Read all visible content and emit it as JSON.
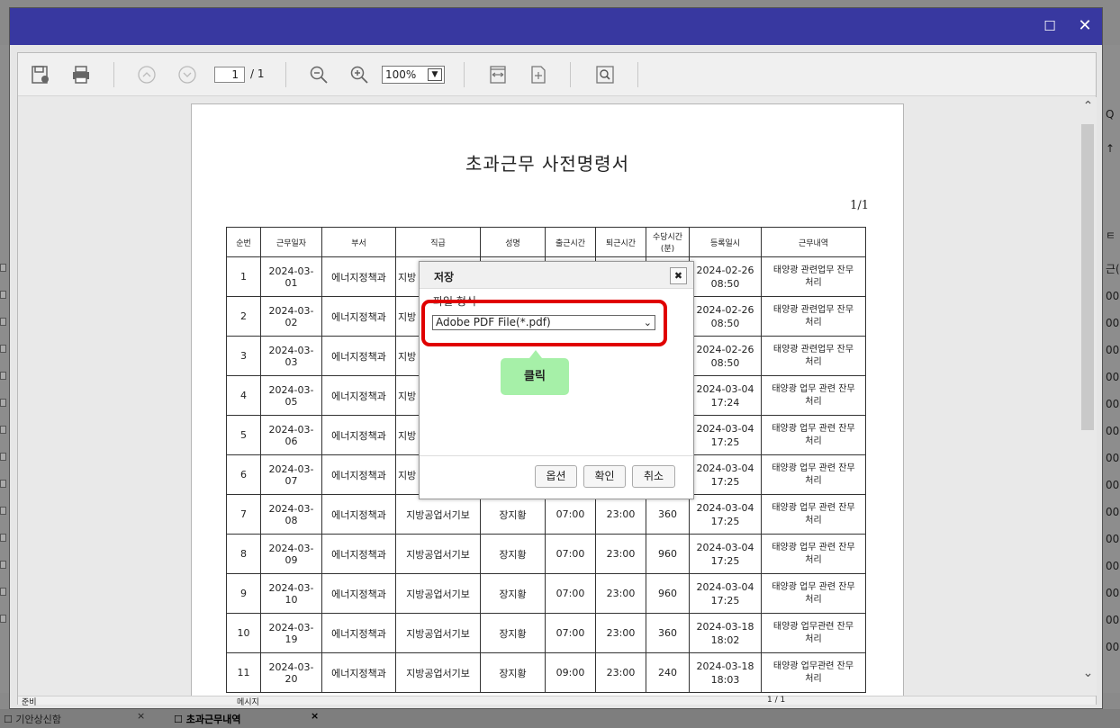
{
  "background": {
    "right_values": [
      "Q",
      "↑",
      "ㅌ",
      "근(",
      "00:",
      "00:",
      "00:",
      "00:",
      "00:",
      "00:",
      "00:",
      "00:",
      "00:",
      "00:",
      "00:",
      "00:",
      "00:",
      "00:"
    ],
    "tabs": [
      {
        "label": "기안상신함",
        "close": "×"
      },
      {
        "label": "초과근무내역",
        "close": "×"
      }
    ]
  },
  "window": {
    "maximize_icon": "☐",
    "close_icon": "✕"
  },
  "toolbar": {
    "page_current": "1",
    "page_total": "/ 1",
    "zoom": "100%",
    "zoom_arrow": "▼",
    "icons": [
      "save-icon",
      "print-icon",
      "prev-page-icon",
      "next-page-icon",
      "zoom-out-icon",
      "zoom-in-icon",
      "fit-width-icon",
      "fit-page-icon",
      "search-icon"
    ]
  },
  "document": {
    "title": "초과근무 사전명령서",
    "page_number": "1/1",
    "headers": [
      "순번",
      "근무일자",
      "부서",
      "직급",
      "성명",
      "출근시간",
      "퇴근시간",
      "수당시간\n(분)",
      "등록일시",
      "근무내역"
    ],
    "rows": [
      {
        "no": "1",
        "date": "2024-03-01",
        "dept": "에너지정책과",
        "rank": "지방",
        "name": "",
        "in": "",
        "out": "",
        "minutes": "",
        "reg": "2024-02-26\n08:50",
        "desc": "태양광 관련업무 잔무\n처리"
      },
      {
        "no": "2",
        "date": "2024-03-02",
        "dept": "에너지정책과",
        "rank": "지방",
        "name": "",
        "in": "",
        "out": "",
        "minutes": "",
        "reg": "2024-02-26\n08:50",
        "desc": "태양광 관련업무 잔무\n처리"
      },
      {
        "no": "3",
        "date": "2024-03-03",
        "dept": "에너지정책과",
        "rank": "지방",
        "name": "",
        "in": "",
        "out": "",
        "minutes": "",
        "reg": "2024-02-26\n08:50",
        "desc": "태양광 관련업무 잔무\n처리"
      },
      {
        "no": "4",
        "date": "2024-03-05",
        "dept": "에너지정책과",
        "rank": "지방",
        "name": "",
        "in": "",
        "out": "",
        "minutes": "",
        "reg": "2024-03-04\n17:24",
        "desc": "태양광 업무 관련 잔무\n처리"
      },
      {
        "no": "5",
        "date": "2024-03-06",
        "dept": "에너지정책과",
        "rank": "지방",
        "name": "",
        "in": "",
        "out": "",
        "minutes": "",
        "reg": "2024-03-04\n17:25",
        "desc": "태양광 업무 관련 잔무\n처리"
      },
      {
        "no": "6",
        "date": "2024-03-07",
        "dept": "에너지정책과",
        "rank": "지방",
        "name": "",
        "in": "",
        "out": "",
        "minutes": "",
        "reg": "2024-03-04\n17:25",
        "desc": "태양광 업무 관련 잔무\n처리"
      },
      {
        "no": "7",
        "date": "2024-03-08",
        "dept": "에너지정책과",
        "rank": "지방공업서기보",
        "name": "장지황",
        "in": "07:00",
        "out": "23:00",
        "minutes": "360",
        "reg": "2024-03-04\n17:25",
        "desc": "태양광 업무 관련 잔무\n처리"
      },
      {
        "no": "8",
        "date": "2024-03-09",
        "dept": "에너지정책과",
        "rank": "지방공업서기보",
        "name": "장지황",
        "in": "07:00",
        "out": "23:00",
        "minutes": "960",
        "reg": "2024-03-04\n17:25",
        "desc": "태양광 업무 관련 잔무\n처리"
      },
      {
        "no": "9",
        "date": "2024-03-10",
        "dept": "에너지정책과",
        "rank": "지방공업서기보",
        "name": "장지황",
        "in": "07:00",
        "out": "23:00",
        "minutes": "960",
        "reg": "2024-03-04\n17:25",
        "desc": "태양광 업무 관련 잔무\n처리"
      },
      {
        "no": "10",
        "date": "2024-03-19",
        "dept": "에너지정책과",
        "rank": "지방공업서기보",
        "name": "장지황",
        "in": "07:00",
        "out": "23:00",
        "minutes": "360",
        "reg": "2024-03-18\n18:02",
        "desc": "태양광 업무관련 잔무\n처리"
      },
      {
        "no": "11",
        "date": "2024-03-20",
        "dept": "에너지정책과",
        "rank": "지방공업서기보",
        "name": "장지황",
        "in": "09:00",
        "out": "23:00",
        "minutes": "240",
        "reg": "2024-03-18\n18:03",
        "desc": "태양광 업무관련 잔무\n처리"
      }
    ]
  },
  "statusbar": {
    "left": "준비",
    "mid": "메시지",
    "right": "1 / 1"
  },
  "dialog": {
    "title": "저장",
    "close": "✖",
    "label": "파일 형식",
    "select_value": "Adobe PDF File(*.pdf)",
    "select_arrow": "⌄",
    "buttons": {
      "options": "옵션",
      "ok": "확인",
      "cancel": "취소"
    }
  },
  "annotation": {
    "callout": "클릭",
    "highlight_color": "#e00000",
    "callout_color": "#a6f0a8"
  },
  "colors": {
    "titlebar": "#3838a0"
  }
}
